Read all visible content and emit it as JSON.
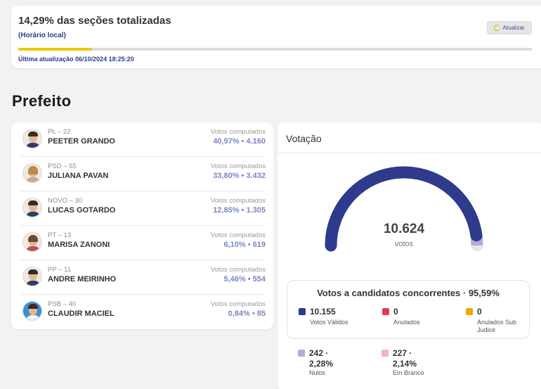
{
  "status": {
    "title": "14,29% das seções totalizadas",
    "subtitle": "(Horário local)",
    "progress_percent": 14.29,
    "refresh_label": "Atualizar",
    "last_update": "Última atualização 06/10/2024 18:25:20"
  },
  "section_title": "Prefeito",
  "candidates": [
    {
      "party": "PL – 22",
      "name": "PEETER GRANDO",
      "votes_label": "Votos computados",
      "votes": "40,97% • 4.160"
    },
    {
      "party": "PSD – 55",
      "name": "JULIANA PAVAN",
      "votes_label": "Votos computados",
      "votes": "33,80% • 3.432"
    },
    {
      "party": "NOVO – 30",
      "name": "LUCAS GOTARDO",
      "votes_label": "Votos computados",
      "votes": "12,85% • 1.305"
    },
    {
      "party": "PT – 13",
      "name": "MARISA ZANONI",
      "votes_label": "Votos computados",
      "votes": "6,10% • 619"
    },
    {
      "party": "PP – 11",
      "name": "ANDRE MEIRINHO",
      "votes_label": "Votos computados",
      "votes": "5,46% • 554"
    },
    {
      "party": "PSB – 40",
      "name": "CLAUDIR MACIEL",
      "votes_label": "Votos computados",
      "votes": "0,84% • 85"
    }
  ],
  "voting": {
    "title": "Votação",
    "total": "10.624",
    "unit": "votos",
    "summary_title": "Votos a candidatos concorrentes · 95,59%",
    "valid_fraction": 0.9559,
    "colors": {
      "valid": "#2e3b8c",
      "annulled": "#e8384f",
      "sub_judice": "#f0a500",
      "null": "#b3acd6",
      "blank": "#f4b3c0",
      "track": "#e6e6e6"
    },
    "legend": [
      {
        "value": "10.155",
        "label": "Votos Válidos"
      },
      {
        "value": "0",
        "label": "Anulados"
      },
      {
        "value": "0",
        "label": "Anulados Sub Judice"
      },
      {
        "value": "242 · 2,28%",
        "label": "Nulos"
      },
      {
        "value": "227 · 2,14%",
        "label": "Em Branco"
      }
    ]
  }
}
